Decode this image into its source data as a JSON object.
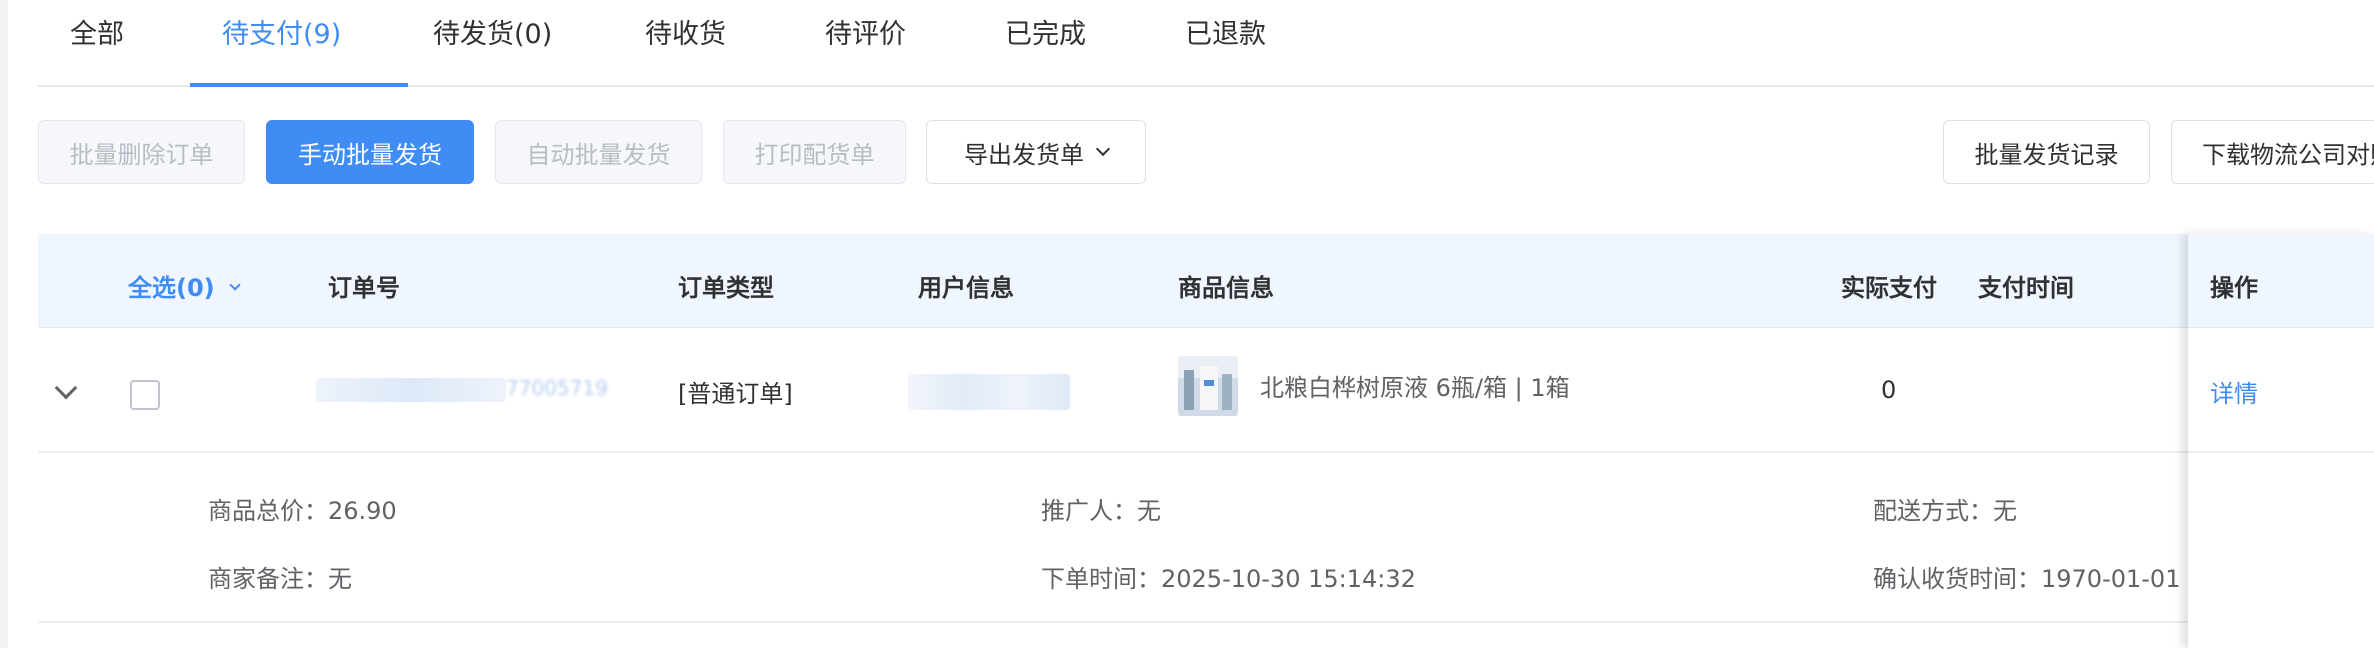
{
  "tabs": [
    {
      "label": "全部",
      "active": false
    },
    {
      "label": "待支付(9)",
      "active": true
    },
    {
      "label": "待发货(0)",
      "active": false
    },
    {
      "label": "待收货",
      "active": false
    },
    {
      "label": "待评价",
      "active": false
    },
    {
      "label": "已完成",
      "active": false
    },
    {
      "label": "已退款",
      "active": false
    }
  ],
  "toolbar": {
    "batch_delete": "批量删除订单",
    "manual_ship": "手动批量发货",
    "auto_ship": "自动批量发货",
    "print_packing": "打印配货单",
    "export_ship": "导出发货单",
    "ship_records": "批量发货记录",
    "download_logistics": "下载物流公司对照表"
  },
  "table": {
    "headers": {
      "select_all": "全选(0)",
      "order_no": "订单号",
      "order_type": "订单类型",
      "user_info": "用户信息",
      "product_info": "商品信息",
      "actual_pay": "实际支付",
      "pay_time": "支付时间",
      "actions": "操作"
    },
    "row": {
      "order_no_partial": "77005719",
      "order_type": "[普通订单]",
      "product": "北粮白桦树原液 6瓶/箱 | 1箱",
      "actual_pay": "0",
      "pay_time": "",
      "detail_link": "详情"
    },
    "detail": {
      "total_price": "商品总价：26.90",
      "promoter": "推广人：无",
      "delivery": "配送方式：无",
      "merchant_note": "商家备注：无",
      "order_time": "下单时间：2025-10-30 15:14:32",
      "confirm_time": "确认收货时间：1970-01-01"
    }
  },
  "colors": {
    "accent": "#3f8cf5",
    "header_bg": "#f0f6ff"
  }
}
